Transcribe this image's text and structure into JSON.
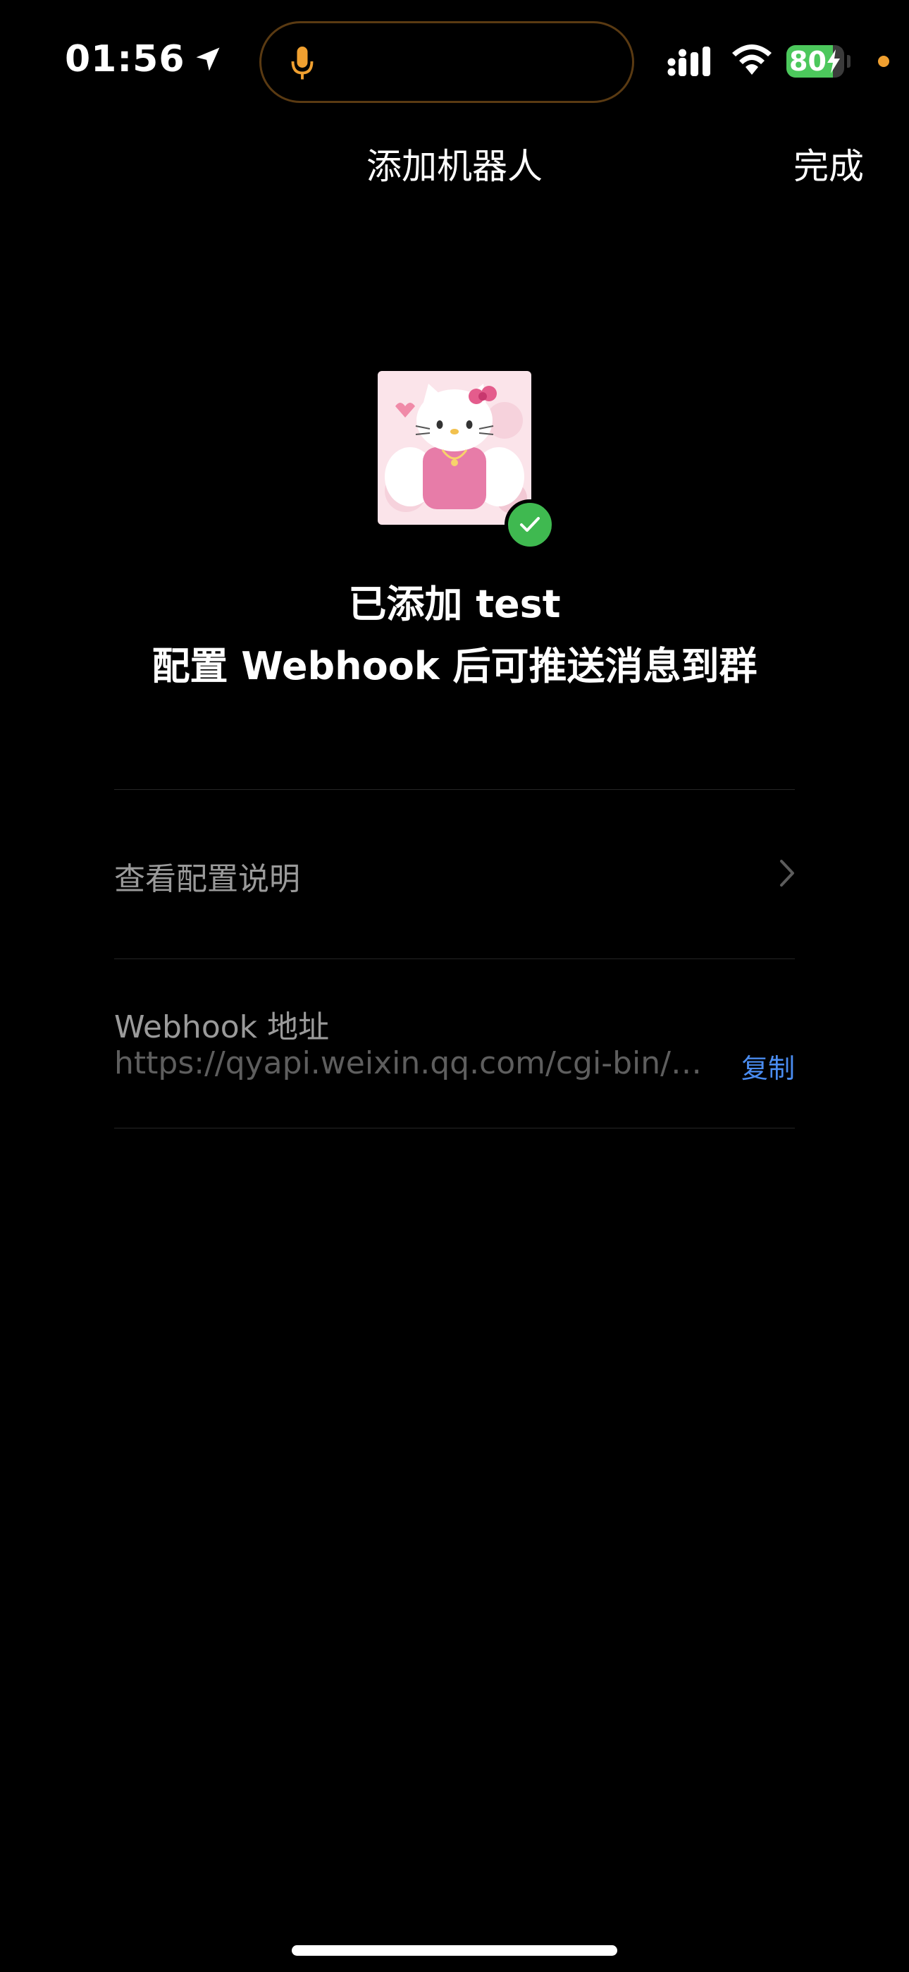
{
  "status_bar": {
    "time": "01:56",
    "battery": "80",
    "battery_level": 0.8,
    "icons": [
      "location-arrow-icon",
      "microphone-icon",
      "cellular-signal-icon",
      "wifi-icon",
      "battery-icon",
      "charging-bolt-icon"
    ]
  },
  "nav": {
    "title": "添加机器人",
    "done_label": "完成"
  },
  "robot": {
    "added_text": "已添加 test",
    "subtitle": "配置 Webhook 后可推送消息到群",
    "avatar_icon": "hello-kitty-avatar",
    "badge_icon": "check-icon"
  },
  "config_row": {
    "label": "查看配置说明",
    "icon": "chevron-right-icon"
  },
  "webhook": {
    "label": "Webhook 地址",
    "url": "https://qyapi.weixin.qq.com/cgi-bin/w...",
    "copy_label": "复制"
  },
  "colors": {
    "background": "#000000",
    "accent_blue": "#4a8cf0",
    "success_green": "#3fb950",
    "battery_green": "#4cc85c",
    "mic_orange": "#f0a030"
  }
}
